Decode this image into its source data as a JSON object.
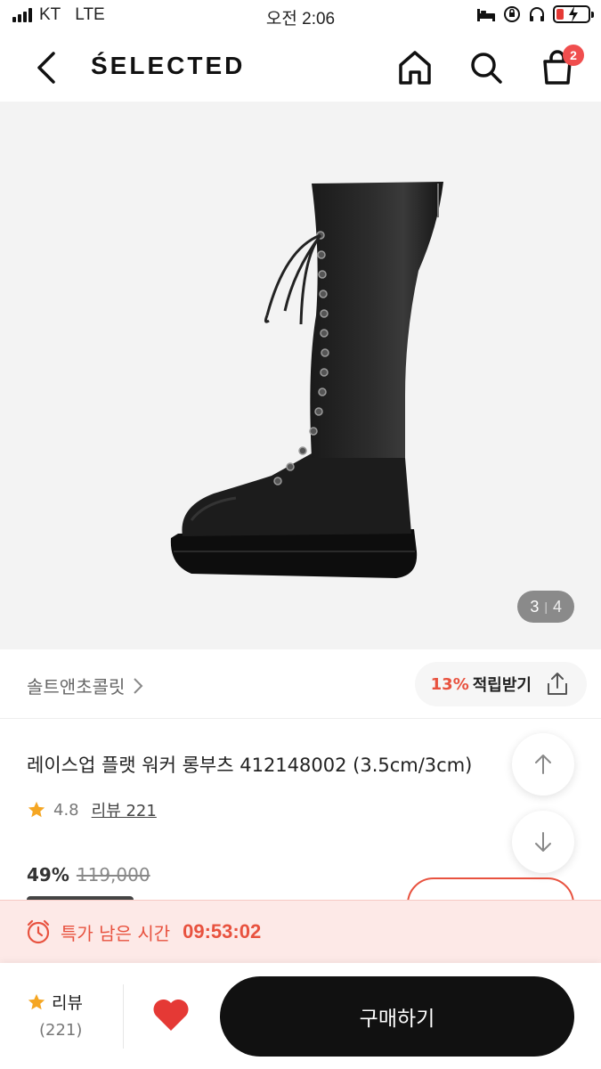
{
  "status_bar": {
    "carrier": "KT",
    "network": "LTE",
    "time": "오전 2:06"
  },
  "header": {
    "logo": "ŚELECTED",
    "cart_count": "2"
  },
  "gallery": {
    "current": "3",
    "separator": "|",
    "total": "4"
  },
  "brand": {
    "name": "솔트앤초콜릿",
    "points_percent": "13%",
    "points_label": "적립받기"
  },
  "product": {
    "title": "레이스업 플랫 워커 롱부츠 412148002 (3.5cm/3cm)",
    "rating": "4.8",
    "review_label": "리뷰 221",
    "discount": "49%",
    "original_price": "119,000"
  },
  "timer": {
    "label": "특가 남은 시간",
    "countdown": "09:53:02"
  },
  "bottom_bar": {
    "review_label": "리뷰",
    "review_count": "(221)",
    "buy_label": "구매하기"
  },
  "colors": {
    "accent": "#e8523f",
    "badge": "#f04e4e",
    "star": "#f5a623",
    "heart": "#e53935",
    "buy_button": "#111111",
    "timer_bg": "#fde9e7"
  }
}
